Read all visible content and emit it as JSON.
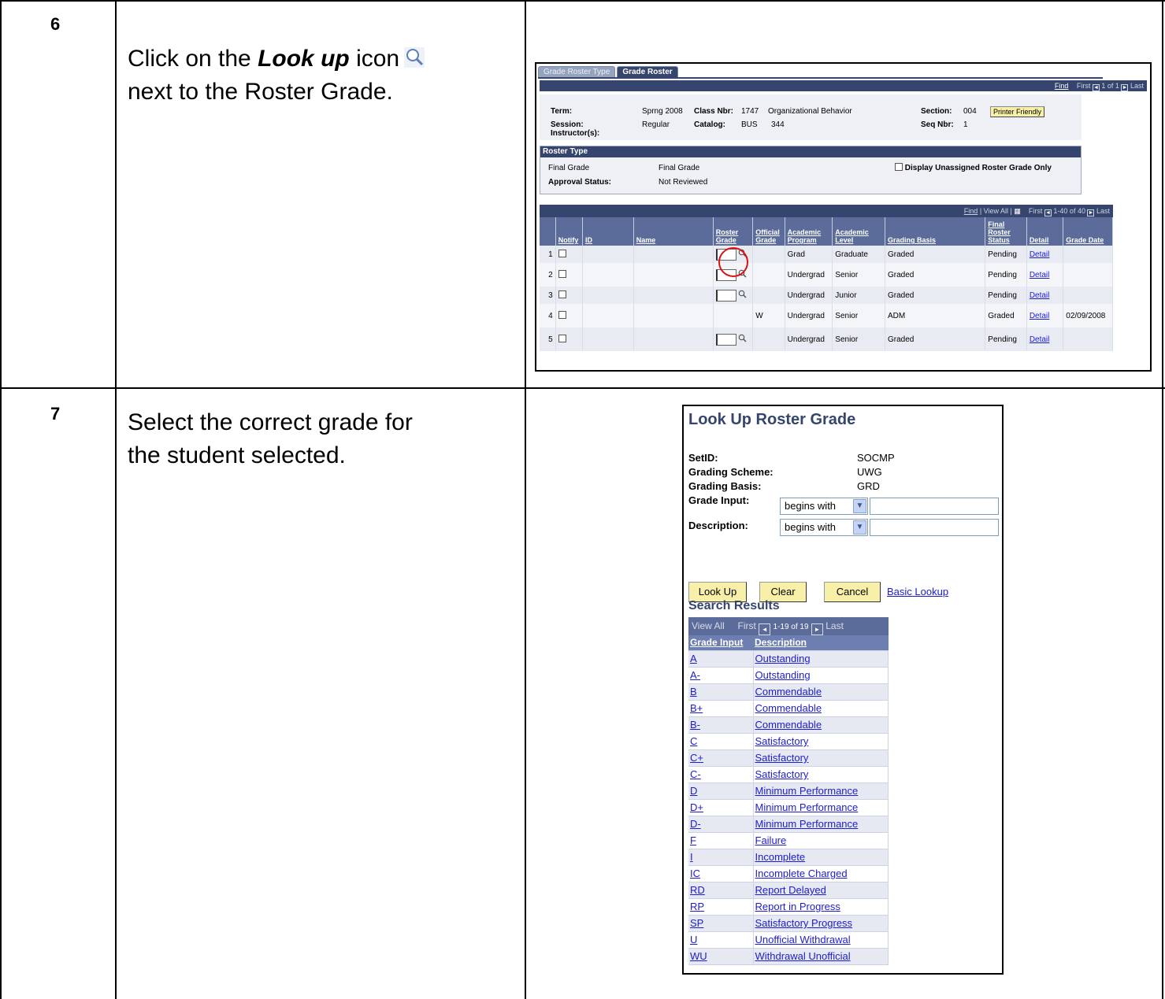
{
  "steps": [
    {
      "number": "6",
      "text_before": "Click on the ",
      "text_emph": "Look up",
      "text_after": " icon",
      "text_line2": "next to the Roster Grade."
    },
    {
      "number": "7",
      "text_line1": "Select the correct grade for",
      "text_line2": "the student selected."
    }
  ],
  "roster": {
    "tabs": [
      "Grade Roster Type",
      "Grade Roster"
    ],
    "nav": {
      "find": "Find",
      "first": "First",
      "range": "1 of 1",
      "last": "Last"
    },
    "term_label": "Term:",
    "term_value": "Sprng 2008",
    "class_nbr_label": "Class Nbr:",
    "class_nbr_value": "1747",
    "course_title": "Organizational Behavior",
    "section_label": "Section:",
    "section_value": "004",
    "printer_friendly": "Printer Friendly",
    "session_label": "Session:",
    "session_value": "Regular",
    "catalog_label": "Catalog:",
    "catalog_subject": "BUS",
    "catalog_number": "344",
    "seq_label": "Seq Nbr:",
    "seq_value": "1",
    "instructor_label": "Instructor(s):",
    "roster_type_heading": "Roster Type",
    "final_grade_label": "Final Grade",
    "final_grade_value": "Final Grade",
    "display_unassigned": "Display Unassigned Roster Grade Only",
    "approval_label": "Approval Status:",
    "approval_value": "Not Reviewed",
    "grid_nav": {
      "find": "Find",
      "view_all": "View All",
      "first": "First",
      "range": "1-40 of 40",
      "last": "Last"
    },
    "columns": [
      "Notify",
      "ID",
      "Name",
      "Roster Grade",
      "Official Grade",
      "Academic Program",
      "Academic Level",
      "Grading Basis",
      "Final Roster Status",
      "Detail",
      "Grade Date"
    ],
    "rows": [
      {
        "num": "1",
        "official": "",
        "program": "Grad",
        "level": "Graduate",
        "basis": "Graded",
        "status": "Pending",
        "detail": "Detail",
        "date": ""
      },
      {
        "num": "2",
        "official": "",
        "program": "Undergrad",
        "level": "Senior",
        "basis": "Graded",
        "status": "Pending",
        "detail": "Detail",
        "date": ""
      },
      {
        "num": "3",
        "official": "",
        "program": "Undergrad",
        "level": "Junior",
        "basis": "Graded",
        "status": "Pending",
        "detail": "Detail",
        "date": ""
      },
      {
        "num": "4",
        "official": "W",
        "program": "Undergrad",
        "level": "Senior",
        "basis": "ADM",
        "status": "Graded",
        "detail": "Detail",
        "date": "02/09/2008"
      },
      {
        "num": "5",
        "official": "",
        "program": "Undergrad",
        "level": "Senior",
        "basis": "Graded",
        "status": "Pending",
        "detail": "Detail",
        "date": ""
      }
    ]
  },
  "lookup": {
    "title": "Look Up Roster Grade",
    "setid_label": "SetID:",
    "setid_value": "SOCMP",
    "scheme_label": "Grading Scheme:",
    "scheme_value": "UWG",
    "basis_label": "Grading Basis:",
    "basis_value": "GRD",
    "grade_input_label": "Grade Input:",
    "grade_input_op": "begins with",
    "grade_input_value": "",
    "description_label": "Description:",
    "description_op": "begins with",
    "description_value": "",
    "btn_lookup": "Look Up",
    "btn_clear": "Clear",
    "btn_cancel": "Cancel",
    "basic_lookup": "Basic Lookup",
    "results_title": "Search Results",
    "results_nav": {
      "view_all": "View All",
      "first": "First",
      "range": "1-19 of 19",
      "last": "Last"
    },
    "results_columns": [
      "Grade Input",
      "Description"
    ],
    "results": [
      [
        "A",
        "Outstanding"
      ],
      [
        "A-",
        "Outstanding"
      ],
      [
        "B",
        "Commendable"
      ],
      [
        "B+",
        "Commendable"
      ],
      [
        "B-",
        "Commendable"
      ],
      [
        "C",
        "Satisfactory"
      ],
      [
        "C+",
        "Satisfactory"
      ],
      [
        "C-",
        "Satisfactory"
      ],
      [
        "D",
        "Minimum Performance"
      ],
      [
        "D+",
        "Minimum Performance"
      ],
      [
        "D-",
        "Minimum Performance"
      ],
      [
        "F",
        "Failure"
      ],
      [
        "I",
        "Incomplete"
      ],
      [
        "IC",
        "Incomplete Charged"
      ],
      [
        "RD",
        "Report Delayed"
      ],
      [
        "RP",
        "Report in Progress"
      ],
      [
        "SP",
        "Satisfactory Progress"
      ],
      [
        "U",
        "Unofficial Withdrawal"
      ],
      [
        "WU",
        "Withdrawal Unofficial"
      ]
    ]
  }
}
